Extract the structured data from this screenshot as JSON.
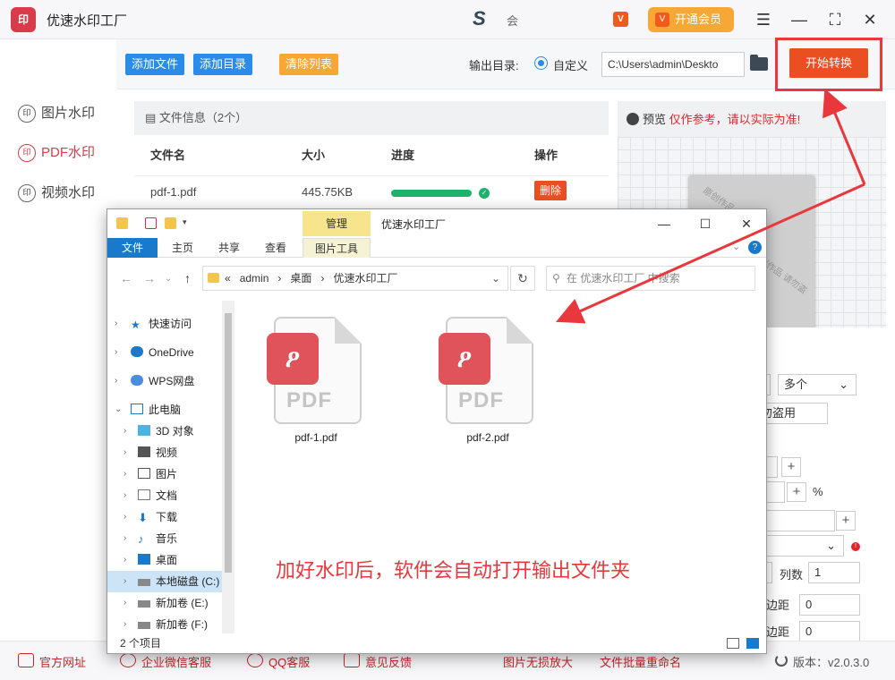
{
  "app": {
    "title": "优速水印工厂",
    "logo_text": "印",
    "top_link": "会",
    "vip_label": "开通会员"
  },
  "sidebar": {
    "items": [
      {
        "label": "图片水印"
      },
      {
        "label": "PDF水印"
      },
      {
        "label": "视频水印"
      }
    ]
  },
  "toolbar": {
    "add_file": "添加文件",
    "add_dir": "添加目录",
    "clear_list": "清除列表",
    "output_label": "输出目录:",
    "radio_label": "自定义",
    "output_path": "C:\\Users\\admin\\Deskto",
    "start_button": "开始转换"
  },
  "files": {
    "header": "文件信息（2个）",
    "columns": [
      "文件名",
      "大小",
      "进度",
      "操作"
    ],
    "rows": [
      {
        "name": "pdf-1.pdf",
        "size": "445.75KB",
        "progress": 1.0,
        "action": "删除"
      }
    ]
  },
  "preview": {
    "label": "预览",
    "note": "仅作参考，请以实际为准!",
    "watermark_text": "原创作品 请勿盗用"
  },
  "settings": {
    "multi": "多个",
    "watermark_text": "勿盗用",
    "percent": "%",
    "cols_label": "列数",
    "cols_value": "1",
    "hmargin_label": "平边距",
    "hmargin_value": "0",
    "vmargin_label": "直边距",
    "vmargin_value": "0"
  },
  "bottom": {
    "links": [
      "官方网址",
      "企业微信客服",
      "QQ客服",
      "意见反馈",
      "图片无损放大",
      "文件批量重命名"
    ],
    "version": "版本：v2.0.3.0"
  },
  "explorer": {
    "title": "优速水印工厂",
    "manage_tab": "管理",
    "ribbon_tabs": [
      "文件",
      "主页",
      "共享",
      "查看",
      "图片工具"
    ],
    "address": [
      "«",
      "admin",
      "›",
      "桌面",
      "›",
      "优速水印工厂"
    ],
    "search_placeholder": "在 优速水印工厂 中搜索",
    "tree": [
      "快速访问",
      "OneDrive",
      "WPS网盘",
      "此电脑",
      "3D 对象",
      "视频",
      "图片",
      "文档",
      "下载",
      "音乐",
      "桌面",
      "本地磁盘 (C:)",
      "新加卷 (E:)",
      "新加卷 (F:)"
    ],
    "files": [
      "pdf-1.pdf",
      "pdf-2.pdf"
    ],
    "status": "2 个项目"
  },
  "annotation": "加好水印后，软件会自动打开输出文件夹",
  "colors": {
    "accent_red": "#e94f21",
    "blue_button": "#2a8ce8",
    "yellow_button": "#f7a735",
    "annotation_red": "#e8383d"
  }
}
